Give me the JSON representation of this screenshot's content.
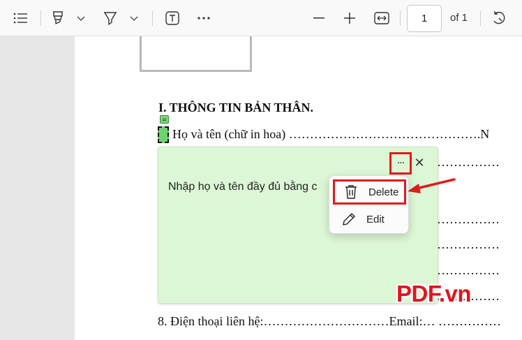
{
  "toolbar": {
    "page_current": "1",
    "page_total_label": "of 1",
    "icons": [
      "contents-icon",
      "highlight-icon",
      "chevron-down-icon",
      "draw-icon",
      "chevron-down-icon",
      "text-box-icon",
      "more-icon",
      "zoom-out-icon",
      "zoom-in-icon",
      "fit-width-icon",
      "rotate-icon"
    ]
  },
  "document": {
    "heading": "I. THÔNG TIN BẢN THÂN.",
    "line1": "Họ và tên (chữ in hoa) ……………………………………….N",
    "line8": "8. Điện thoại liên hệ:…………………………Email:… ……………",
    "dots_rows": [
      "……………",
      "……………",
      "……………",
      "……………",
      "……………",
      "……………"
    ]
  },
  "note": {
    "text": "Nhập họ và tên đầy đủ bằng c",
    "more_label": "···",
    "close_label": "✕"
  },
  "menu": {
    "delete_label": "Delete",
    "edit_label": "Edit"
  },
  "watermark": {
    "text": "PDF.vn"
  },
  "colors": {
    "highlight_red": "#e11b1b",
    "note_green": "#dcf7d5",
    "marker_green": "#6fd26f",
    "watermark_red": "#e3141b"
  }
}
